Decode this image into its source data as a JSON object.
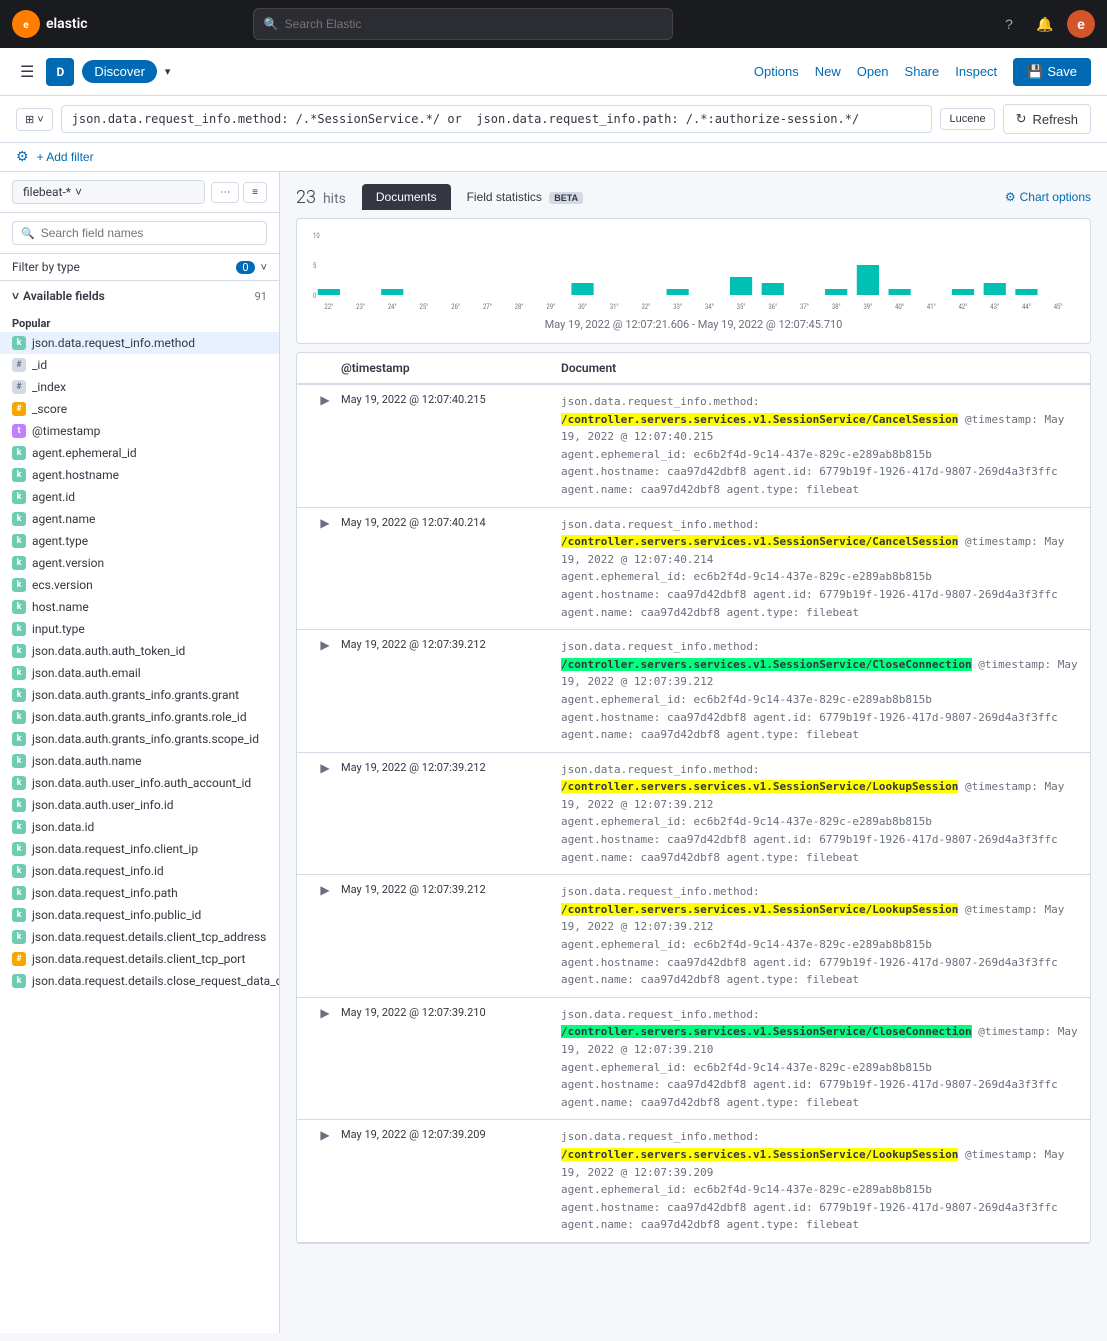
{
  "topNav": {
    "logoText": "elastic",
    "logoInitial": "e",
    "searchPlaceholder": "Search Elastic",
    "navIcons": [
      "help-icon",
      "notification-icon",
      "user-icon"
    ],
    "userInitial": "e"
  },
  "secondaryNav": {
    "appInitial": "D",
    "appName": "Discover",
    "chevron": "▾",
    "actions": {
      "options": "Options",
      "new": "New",
      "open": "Open",
      "share": "Share",
      "inspect": "Inspect",
      "save": "Save"
    }
  },
  "queryBar": {
    "query": "json.data.request_info.method: /.*SessionService.*/ or  json.data.request_info.path: /.*:authorize-session.*/",
    "luceneLabel": "Lucene",
    "refreshLabel": "Refresh"
  },
  "filterBar": {
    "addFilterLabel": "+ Add filter"
  },
  "sidebar": {
    "indexPattern": "filebeat-*",
    "searchPlaceholder": "Search field names",
    "filterType": {
      "label": "Filter by type",
      "count": "0"
    },
    "availableFields": {
      "label": "Available fields",
      "count": "91"
    },
    "popularLabel": "Popular",
    "fields": [
      {
        "name": "json.data.request_info.method",
        "type": "k",
        "active": true
      },
      {
        "name": "_id",
        "type": "id"
      },
      {
        "name": "_index",
        "type": "id"
      },
      {
        "name": "_score",
        "type": "num"
      },
      {
        "name": "@timestamp",
        "type": "time"
      },
      {
        "name": "agent.ephemeral_id",
        "type": "k"
      },
      {
        "name": "agent.hostname",
        "type": "k"
      },
      {
        "name": "agent.id",
        "type": "k"
      },
      {
        "name": "agent.name",
        "type": "k"
      },
      {
        "name": "agent.type",
        "type": "k"
      },
      {
        "name": "agent.version",
        "type": "k"
      },
      {
        "name": "ecs.version",
        "type": "k"
      },
      {
        "name": "host.name",
        "type": "k"
      },
      {
        "name": "input.type",
        "type": "k"
      },
      {
        "name": "json.data.auth.auth_token_id",
        "type": "k"
      },
      {
        "name": "json.data.auth.email",
        "type": "k"
      },
      {
        "name": "json.data.auth.grants_info.grants.grant",
        "type": "k"
      },
      {
        "name": "json.data.auth.grants_info.grants.role_id",
        "type": "k"
      },
      {
        "name": "json.data.auth.grants_info.grants.scope_id",
        "type": "k"
      },
      {
        "name": "json.data.auth.name",
        "type": "k"
      },
      {
        "name": "json.data.auth.user_info.auth_account_id",
        "type": "k"
      },
      {
        "name": "json.data.auth.user_info.id",
        "type": "k"
      },
      {
        "name": "json.data.id",
        "type": "k"
      },
      {
        "name": "json.data.request_info.client_ip",
        "type": "k"
      },
      {
        "name": "json.data.request_info.id",
        "type": "k"
      },
      {
        "name": "json.data.request_info.path",
        "type": "k"
      },
      {
        "name": "json.data.request_info.public_id",
        "type": "k"
      },
      {
        "name": "json.data.request.details.client_tcp_address",
        "type": "k"
      },
      {
        "name": "json.data.request.details.client_tcp_port",
        "type": "num"
      },
      {
        "name": "json.data.request.details.close_request_data_connection_id",
        "type": "k"
      }
    ]
  },
  "hits": {
    "count": "23",
    "label": "hits",
    "tabs": [
      {
        "label": "Documents",
        "active": true
      },
      {
        "label": "Field statistics",
        "active": false,
        "badge": "BETA"
      }
    ],
    "chartOptions": "Chart options"
  },
  "chart": {
    "timeRange": "May 19, 2022 @ 12:07:21.606 - May 19, 2022 @ 12:07:45.710",
    "bars": [
      {
        "label": "22°",
        "value": 1
      },
      {
        "label": "23°",
        "value": 0
      },
      {
        "label": "24°",
        "value": 1
      },
      {
        "label": "25°",
        "value": 0
      },
      {
        "label": "26°",
        "value": 0
      },
      {
        "label": "27°",
        "value": 0
      },
      {
        "label": "28°",
        "value": 0
      },
      {
        "label": "29°",
        "value": 0
      },
      {
        "label": "30°",
        "value": 2
      },
      {
        "label": "31°",
        "value": 0
      },
      {
        "label": "32°",
        "value": 0
      },
      {
        "label": "33°",
        "value": 1
      },
      {
        "label": "34°",
        "value": 0
      },
      {
        "label": "35°",
        "value": 3
      },
      {
        "label": "36°",
        "value": 2
      },
      {
        "label": "37°",
        "value": 0
      },
      {
        "label": "38°",
        "value": 1
      },
      {
        "label": "39°",
        "value": 5
      },
      {
        "label": "40°",
        "value": 1
      },
      {
        "label": "41°",
        "value": 0
      },
      {
        "label": "42°",
        "value": 1
      },
      {
        "label": "43°",
        "value": 2
      },
      {
        "label": "44°",
        "value": 1
      },
      {
        "label": "45°",
        "value": 0
      }
    ]
  },
  "tableHeader": {
    "expand": "",
    "timestamp": "@timestamp",
    "document": "Document"
  },
  "rows": [
    {
      "timestamp": "May 19, 2022 @ 12:07:40.215",
      "methodHighlight": "/controller.servers.services.v1.Sessi",
      "methodHighlight2": "onService/CancelSession",
      "method": "/controller.servers.services.v1.SessionService/CancelSession",
      "tsField": "@timestamp: May 19, 2022 @ 12:07:40.215",
      "ephemeral": "agent.ephemeral_id: ec6b2f4d-9c14-437e-829c-e289ab8b815b",
      "hostname": "agent.hostname: caa97d42dbf8",
      "agentId": "agent.id: 6779b19f-1926-417d-9807-269d4a3f3ffc",
      "agentName": "agent.name: caa97d42dbf8",
      "agentType": "agent.type: filebeat"
    },
    {
      "timestamp": "May 19, 2022 @ 12:07:40.214",
      "methodHighlight": "/controller.servers.services.v1.Sessi",
      "methodHighlight2": "onService/CancelSession",
      "method": "/controller.servers.services.v1.SessionService/CancelSession",
      "tsField": "@timestamp: May 19, 2022 @ 12:07:40.214",
      "ephemeral": "agent.ephemeral_id: ec6b2f4d-9c14-437e-829c-e289ab8b815b",
      "hostname": "agent.hostname: caa97d42dbf8",
      "agentId": "agent.id: 6779b19f-1926-417d-9807-269d4a3f3ffc",
      "agentName": "agent.name: caa97d42dbf8",
      "agentType": "agent.type: filebeat"
    },
    {
      "timestamp": "May 19, 2022 @ 12:07:39.212",
      "methodHighlight": "/controller.servers.services.v1.Sessi",
      "methodHighlight2": "onService/CloseConnection",
      "method": "/controller.servers.services.v1.SessionService/CloseConnection",
      "tsField": "@timestamp: May 19, 2022 @ 12:07:39.212",
      "ephemeral": "agent.ephemeral_id: ec6b2f4d-9c14-437e-829c-e289ab8b815b",
      "hostname": "agent.hostname: caa97d42dbf8",
      "agentId": "agent.id: 6779b19f-1926-417d-9807-269d4a3f3ffc",
      "agentName": "agent.name: caa97d42dbf8",
      "agentType": "agent.type: filebeat"
    },
    {
      "timestamp": "May 19, 2022 @ 12:07:39.212",
      "methodHighlight": "/controller.servers.services.v1.Sessi",
      "methodHighlight2": "onService/LookupSession",
      "method": "/controller.servers.services.v1.SessionService/LookupSession",
      "tsField": "@timestamp: May 19, 2022 @ 12:07:39.212",
      "ephemeral": "agent.ephemeral_id: ec6b2f4d-9c14-437e-829c-e289ab8b815b",
      "hostname": "agent.hostname: caa97d42dbf8",
      "agentId": "agent.id: 6779b19f-1926-417d-9807-269d4a3f3ffc",
      "agentName": "agent.name: caa97d42dbf8",
      "agentType": "agent.type: filebeat"
    },
    {
      "timestamp": "May 19, 2022 @ 12:07:39.212",
      "methodHighlight": "/controller.servers.services.v1.Sessi",
      "methodHighlight2": "onService/LookupSession",
      "method": "/controller.servers.services.v1.SessionService/LookupSession",
      "tsField": "@timestamp: May 19, 2022 @ 12:07:39.212",
      "ephemeral": "agent.ephemeral_id: ec6b2f4d-9c14-437e-829c-e289ab8b815b",
      "hostname": "agent.hostname: caa97d42dbf8",
      "agentId": "agent.id: 6779b19f-1926-417d-9807-269d4a3f3ffc",
      "agentName": "agent.name: caa97d42dbf8",
      "agentType": "agent.type: filebeat"
    },
    {
      "timestamp": "May 19, 2022 @ 12:07:39.210",
      "methodHighlight": "/controller.servers.services.v1.Sessi",
      "methodHighlight2": "onService/CloseConnection",
      "method": "/controller.servers.services.v1.SessionService/CloseConnection",
      "tsField": "@timestamp: May 19, 2022 @ 12:07:39.210",
      "ephemeral": "agent.ephemeral_id: ec6b2f4d-9c14-437e-829c-e289ab8b815b",
      "hostname": "agent.hostname: caa97d42dbf8",
      "agentId": "agent.id: 6779b19f-1926-417d-9807-269d4a3f3ffc",
      "agentName": "agent.name: caa97d42dbf8",
      "agentType": "agent.type: filebeat"
    },
    {
      "timestamp": "May 19, 2022 @ 12:07:39.209",
      "methodHighlight": "/controller.servers.services.v1.Sessi",
      "methodHighlight2": "onService/LookupSession",
      "method": "/controller.servers.services.v1.SessionService/LookupSession",
      "tsField": "@timestamp: May 19, 2022 @ 12:07:39.209",
      "ephemeral": "agent.ephemeral_id: ec6b2f4d-9c14-437e-829c-e289ab8b815b",
      "hostname": "agent.hostname: caa97d42dbf8",
      "agentId": "agent.id: 6779b19f-1926-417d-9807-269d4a3f3ffc",
      "agentName": "agent.name: caa97d42dbf8",
      "agentType": "agent.type: filebeat"
    }
  ]
}
